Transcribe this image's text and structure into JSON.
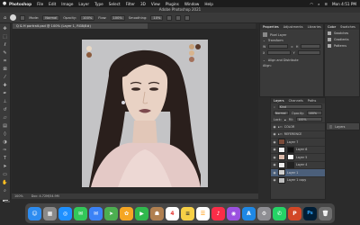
{
  "menubar": {
    "apple": "",
    "app": "Photoshop",
    "items": [
      "File",
      "Edit",
      "Image",
      "Layer",
      "Type",
      "Select",
      "Filter",
      "3D",
      "View",
      "Plugins",
      "Window",
      "Help"
    ],
    "clock": "Mon 4:51 PM"
  },
  "title": "Adobe Photoshop 2021",
  "options": {
    "size": "",
    "mode_label": "Normal",
    "opacity_label": "Opacity:",
    "opacity_value": "100%",
    "flow_label": "Flow:",
    "flow_value": "100%",
    "smoothing_label": "Smoothing:",
    "smoothing_value": "10%"
  },
  "document_tab": "Q & H portrait.psd @ 100% (Layer 1, RGB/8#)",
  "status": {
    "zoom": "100%",
    "doc": "Doc: 4.72M/54.9M"
  },
  "properties": {
    "tabs": [
      "Properties",
      "Adjustments",
      "Libraries"
    ],
    "section_transform": "Transform",
    "w_label": "W",
    "h_label": "H",
    "x_label": "X",
    "y_label": "Y",
    "section_align": "Align and Distribute",
    "align_label": "Align:"
  },
  "libraries": {
    "tabs": [
      "Color",
      "Swatches"
    ],
    "items": [
      "Swatches",
      "Gradients",
      "Patterns"
    ]
  },
  "layers_panel": {
    "tabs": [
      "Layers",
      "Channels",
      "Paths"
    ],
    "kind_label": "Kind",
    "blend": "Normal",
    "opacity_label": "Opacity:",
    "opacity_value": "100%",
    "lock_label": "Lock:",
    "fill_label": "Fill:",
    "fill_value": "100%",
    "layers": [
      {
        "name": "COLOR"
      },
      {
        "name": "REFERENCE"
      },
      {
        "name": "Layer 7"
      },
      {
        "name": "Layer 6"
      },
      {
        "name": "Layer 5"
      },
      {
        "name": "Layer 4"
      },
      {
        "name": "Layer 1"
      },
      {
        "name": "Layer 1 copy"
      }
    ],
    "collapsed_label": "Layers"
  },
  "swatches_on_canvas": [
    "#e9d9c5",
    "#8b5a3c",
    "#c9a27a",
    "#5b3a2a",
    "#d8b48e",
    "#a4705a"
  ],
  "dock": {
    "apps": [
      {
        "name": "Finder",
        "color": "#2d8cf0",
        "glyph": "☺"
      },
      {
        "name": "Launchpad",
        "color": "#8a8a8a",
        "glyph": "▦"
      },
      {
        "name": "Safari",
        "color": "#1e90ff",
        "glyph": "◎"
      },
      {
        "name": "Messages",
        "color": "#33c759",
        "glyph": "✉"
      },
      {
        "name": "Mail",
        "color": "#3b82f6",
        "glyph": "✉"
      },
      {
        "name": "Maps",
        "color": "#4caf50",
        "glyph": "➤"
      },
      {
        "name": "Photos",
        "color": "#f5a623",
        "glyph": "✿"
      },
      {
        "name": "FaceTime",
        "color": "#30b94d",
        "glyph": "▶"
      },
      {
        "name": "Contacts",
        "color": "#b08050",
        "glyph": "☗"
      },
      {
        "name": "Calendar",
        "color": "#ffffff",
        "glyph": "4"
      },
      {
        "name": "Notes",
        "color": "#f7d046",
        "glyph": "≡"
      },
      {
        "name": "Reminders",
        "color": "#ffffff",
        "glyph": "☰"
      },
      {
        "name": "Music",
        "color": "#fa2d48",
        "glyph": "♪"
      },
      {
        "name": "Podcasts",
        "color": "#9b51e0",
        "glyph": "◉"
      },
      {
        "name": "App Store",
        "color": "#1e88e5",
        "glyph": "A"
      },
      {
        "name": "Settings",
        "color": "#8e8e93",
        "glyph": "⚙"
      },
      {
        "name": "WhatsApp",
        "color": "#25d366",
        "glyph": "✆"
      },
      {
        "name": "PowerPoint",
        "color": "#d24726",
        "glyph": "P"
      },
      {
        "name": "Photoshop",
        "color": "#001e36",
        "glyph": "Ps"
      },
      {
        "name": "Trash",
        "color": "#6e6e6e",
        "glyph": "🗑"
      }
    ]
  }
}
